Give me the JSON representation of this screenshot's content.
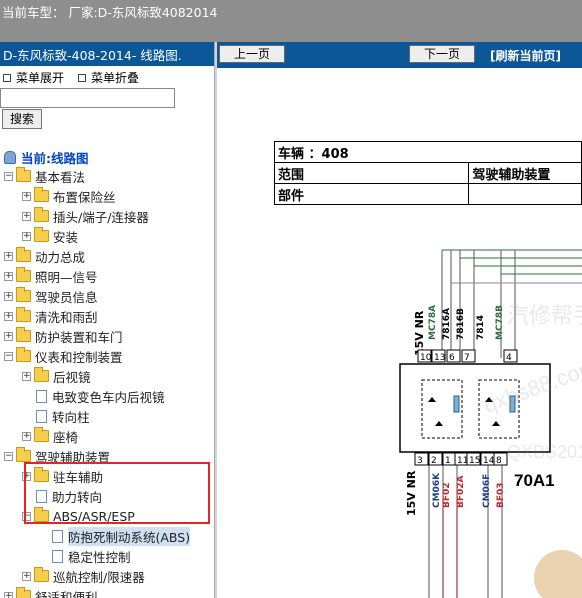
{
  "top_bar": {
    "text": "当前车型： 厂家:D-东风标致4082014"
  },
  "left_panel": {
    "title": "D-东风标致-408-2014- 线路图.",
    "expand_label": "菜单展开",
    "collapse_label": "菜单折叠",
    "search_value": "",
    "search_button": "搜索",
    "current_label": "当前:线路图",
    "tree": [
      {
        "label": "基本看法",
        "level": 0,
        "type": "folder",
        "exp": "−"
      },
      {
        "label": "布置保险丝",
        "level": 1,
        "type": "folder",
        "exp": "+"
      },
      {
        "label": "插头/端子/连接器",
        "level": 1,
        "type": "folder",
        "exp": "+"
      },
      {
        "label": "安装",
        "level": 1,
        "type": "folder",
        "exp": "+"
      },
      {
        "label": "动力总成",
        "level": 0,
        "type": "folder",
        "exp": "+"
      },
      {
        "label": "照明—信号",
        "level": 0,
        "type": "folder",
        "exp": "+"
      },
      {
        "label": "驾驶员信息",
        "level": 0,
        "type": "folder",
        "exp": "+"
      },
      {
        "label": "清洗和雨刮",
        "level": 0,
        "type": "folder",
        "exp": "+"
      },
      {
        "label": "防护装置和车门",
        "level": 0,
        "type": "folder",
        "exp": "+"
      },
      {
        "label": "仪表和控制装置",
        "level": 0,
        "type": "folder",
        "exp": "−"
      },
      {
        "label": "后视镜",
        "level": 1,
        "type": "folder",
        "exp": "+"
      },
      {
        "label": "电致变色车内后视镜",
        "level": 1,
        "type": "doc",
        "exp": ""
      },
      {
        "label": "转向柱",
        "level": 1,
        "type": "doc",
        "exp": ""
      },
      {
        "label": "座椅",
        "level": 1,
        "type": "folder",
        "exp": "+"
      },
      {
        "label": "驾驶辅助装置",
        "level": 0,
        "type": "folder",
        "exp": "−"
      },
      {
        "label": "驻车辅助",
        "level": 1,
        "type": "folder",
        "exp": "+"
      },
      {
        "label": "助力转向",
        "level": 1,
        "type": "doc",
        "exp": ""
      },
      {
        "label": "ABS/ASR/ESP",
        "level": 1,
        "type": "folder",
        "exp": "−"
      },
      {
        "label": "防抱死制动系统(ABS)",
        "level": 2,
        "type": "doc",
        "exp": "",
        "selected": true
      },
      {
        "label": "稳定性控制",
        "level": 2,
        "type": "doc",
        "exp": ""
      },
      {
        "label": "巡航控制/限速器",
        "level": 1,
        "type": "folder",
        "exp": "+"
      },
      {
        "label": "舒适和便利",
        "level": 0,
        "type": "folder",
        "exp": "+"
      }
    ]
  },
  "right_panel": {
    "prev_button": "上一页",
    "next_button": "下一页",
    "refresh_link": "[刷新当前页]",
    "info_table": {
      "vehicle_label": "车辆 ：408",
      "scope_label": "范围",
      "scope_value": "驾驶辅助装置",
      "part_label": "部件"
    },
    "diagram": {
      "top_pin_labels": [
        "15V NR",
        "MC78A",
        "7816A",
        "7816B",
        "7814",
        "MC78B"
      ],
      "top_pin_numbers": [
        "10",
        "13",
        "6",
        "7",
        "4"
      ],
      "bottom_pin_labels": [
        "15V NR",
        "CM06K",
        "BF02",
        "BF02A",
        "CM06F",
        "BF03"
      ],
      "bottom_pin_numbers": [
        "3",
        "2",
        "1",
        "11",
        "15",
        "14",
        "8"
      ],
      "component": "70A1"
    }
  },
  "colors": {
    "header_blue": "#0b5798",
    "top_gray": "#8e8e8e",
    "highlight_red": "#e0262b"
  }
}
